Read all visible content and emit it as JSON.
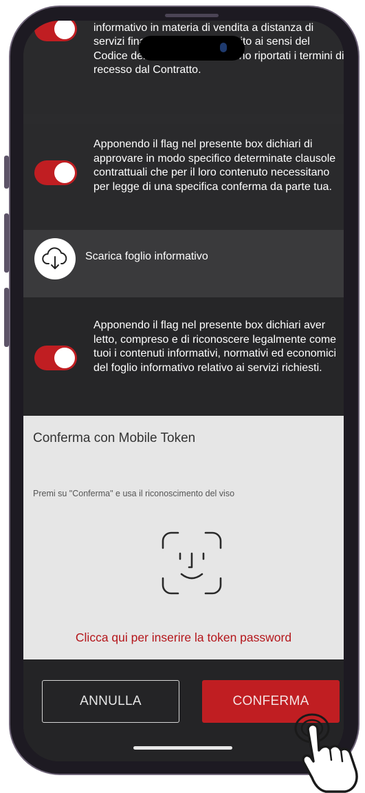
{
  "consents": [
    {
      "text": "dello stesso nonché di aver ricevuto il documento informativo in materia di vendita a distanza di servizi finanziari redatto e fornito ai sensi del Codice del Consumo in cui sono riportati i termini di recesso dal Contratto.",
      "checked": true
    },
    {
      "text": "Apponendo il flag nel presente box dichiari di approvare in modo specifico determinate clausole contrattuali che per il loro contenuto necessitano per legge di una specifica conferma da parte tua.",
      "checked": true
    },
    {
      "text": "Apponendo il flag nel presente box dichiari aver letto, compreso e di riconoscere legalmente come tuoi i contenuti informativi, normativi ed economici del foglio informativo relativo ai servizi richiesti.",
      "checked": true
    }
  ],
  "download": {
    "label": "Scarica foglio informativo",
    "icon": "cloud-download-icon"
  },
  "token": {
    "title": "Conferma con Mobile Token",
    "subtitle": "Premi su \"Conferma\" e usa il riconoscimento del viso",
    "icon": "face-id-icon",
    "link": "Clicca qui per inserire la token password"
  },
  "actions": {
    "cancel": "ANNULLA",
    "confirm": "CONFERMA"
  },
  "colors": {
    "accent": "#c01e22",
    "link": "#b4161b",
    "dark_bg": "#2a2a2c",
    "panel_bg": "#e6e6e6"
  }
}
